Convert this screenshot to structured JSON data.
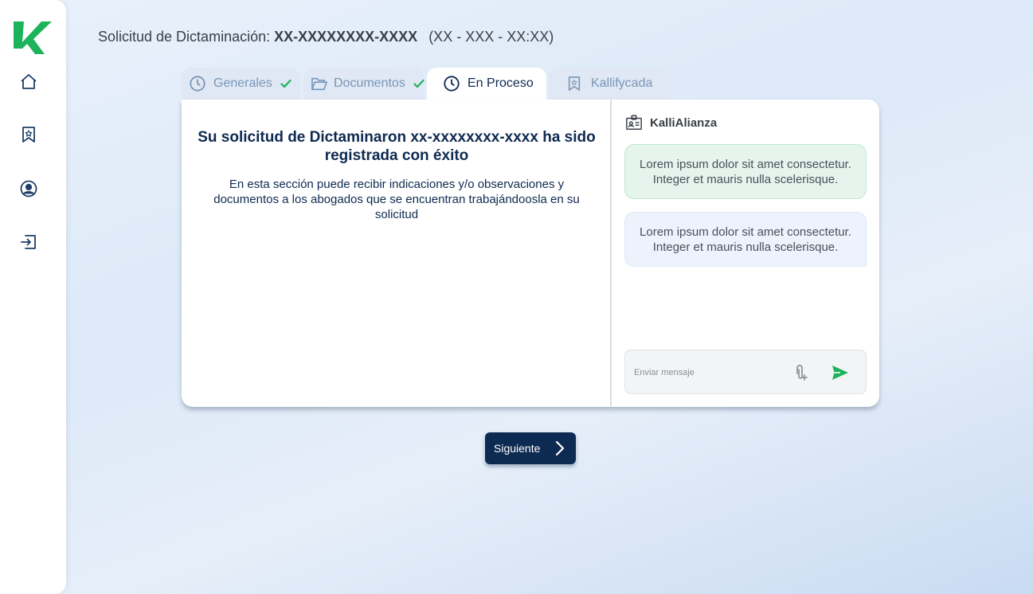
{
  "header": {
    "prefix": "Solicitud de Dictaminación: ",
    "code": "XX-XXXXXXXX-XXXX",
    "time": "(XX - XXX - XX:XX)"
  },
  "tabs": [
    {
      "label": "Generales",
      "icon": "clock-icon",
      "completed": true
    },
    {
      "label": "Documentos",
      "icon": "folder-open-icon",
      "completed": true
    },
    {
      "label": "En Proceso",
      "icon": "clock-icon",
      "active": true
    },
    {
      "label": "Kallifycada",
      "icon": "bookmark-star-icon"
    }
  ],
  "main": {
    "title": "Su solicitud de Dictaminaron xx-xxxxxxxx-xxxx ha sido registrada con éxito",
    "description": "En esta sección puede recibir indicaciones y/o observaciones y documentos a  los abogados que se encuentran trabajándoosla en su solicitud"
  },
  "chat": {
    "title": "KalliAlianza",
    "messages": [
      {
        "text": "Lorem ipsum dolor sit amet consectetur. Integer et mauris nulla scelerisque.",
        "type": "sent"
      },
      {
        "text": "Lorem ipsum dolor sit amet consectetur. Integer et mauris nulla scelerisque.",
        "type": "received"
      }
    ],
    "input_placeholder": "Enviar mensaje"
  },
  "next_button": {
    "label": "Siguiente"
  },
  "sidebar": {
    "items": [
      {
        "icon": "home-icon"
      },
      {
        "icon": "bookmark-star-icon"
      },
      {
        "icon": "user-circle-icon"
      },
      {
        "icon": "logout-icon"
      }
    ]
  },
  "colors": {
    "primary_navy": "#0d2a52",
    "accent_green": "#1db35a",
    "inactive_tab_text": "#7a96b8",
    "sent_bubble": "#e5f5ee",
    "received_bubble": "#edf3fc"
  }
}
